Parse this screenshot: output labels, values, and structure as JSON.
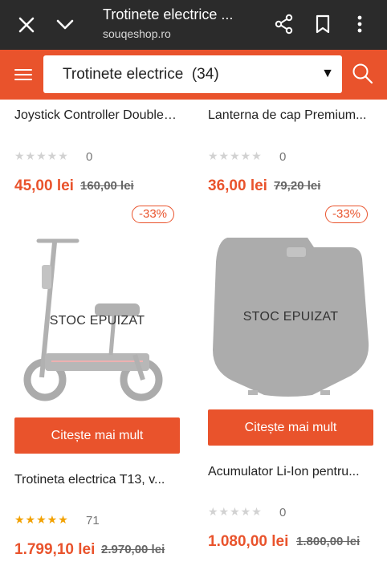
{
  "browser": {
    "title": "Trotinete electrice ...",
    "url": "souqeshop.ro",
    "close_icon": "close-icon",
    "tabs_icon": "chevron-down-icon",
    "share_icon": "share-icon",
    "bookmark_icon": "bookmark-icon",
    "menu_icon": "more-vert-icon"
  },
  "header": {
    "category_label": "Trotinete electrice  (34)",
    "dropdown_arrow": "▼",
    "menu_icon": "hamburger-icon",
    "search_icon": "search-icon",
    "brand_color": "#e9532c"
  },
  "products": [
    {
      "title": "Joystick Controller Double Shock...",
      "stars": "★★★★★",
      "rating_count": "0",
      "price": "45,00 lei",
      "old_price": "160,00 lei"
    },
    {
      "title": "Lanterna de cap Premium...",
      "stars": "★★★★★",
      "rating_count": "0",
      "price": "36,00 lei",
      "old_price": "79,20 lei"
    },
    {
      "discount": "-33%",
      "stock_status": "STOC EPUIZAT",
      "cta": "Citește mai mult",
      "title": "Trotineta electrica T13, v...",
      "stars": "★★★★★",
      "rating_count": "71",
      "price": "1.799,10 lei",
      "old_price": "2.970,00 lei"
    },
    {
      "discount": "-33%",
      "stock_status": "STOC EPUIZAT",
      "cta": "Citește mai mult",
      "title": "Acumulator Li-Ion pentru...",
      "stars": "★★★★★",
      "rating_count": "0",
      "price": "1.080,00 lei",
      "old_price": "1.800,00 lei"
    }
  ]
}
